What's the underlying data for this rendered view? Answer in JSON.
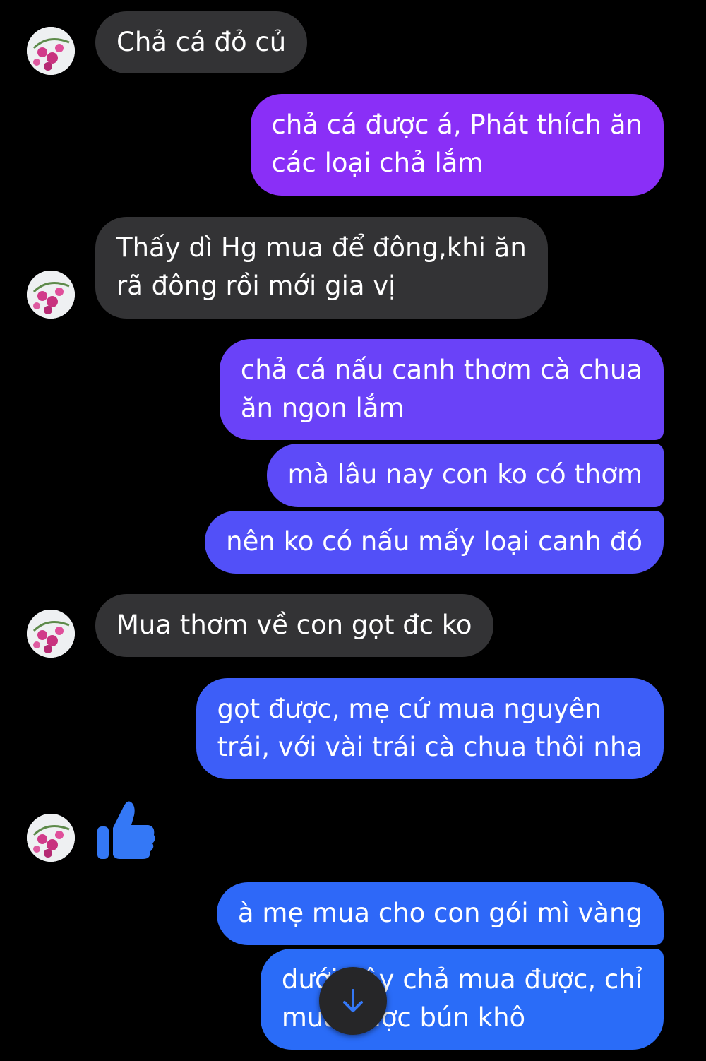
{
  "theme": {
    "background": "#000000",
    "incoming_bubble": "#333335",
    "outgoing_gradient_top": "#8C2EF7",
    "outgoing_gradient_bottom": "#1F6BF8",
    "accent_blue": "#3478F6"
  },
  "messages": [
    {
      "sender": "mother",
      "lines": [
        "Chả cá đỏ củ"
      ]
    },
    {
      "sender": "me",
      "lines": [
        "chả cá được á, Phát thích ăn",
        "các loại chả lắm"
      ]
    },
    {
      "sender": "mother",
      "lines": [
        "Thấy dì Hg mua để đông,khi ăn",
        "rã đông rồi mới gia vị"
      ]
    },
    {
      "sender": "me",
      "lines": [
        "chả cá nấu canh thơm cà chua",
        "ăn ngon lắm"
      ]
    },
    {
      "sender": "me",
      "lines": [
        "mà lâu nay con ko có thơm"
      ]
    },
    {
      "sender": "me",
      "lines": [
        "nên ko có nấu mấy loại canh đó"
      ]
    },
    {
      "sender": "mother",
      "lines": [
        "Mua thơm về con gọt đc ko"
      ]
    },
    {
      "sender": "me",
      "lines": [
        "gọt được, mẹ cứ mua nguyên",
        "trái, với vài trái cà chua thôi nha"
      ]
    },
    {
      "sender": "mother",
      "type": "like",
      "icon": "thumbs-up-icon"
    },
    {
      "sender": "me",
      "lines": [
        "à mẹ mua cho con gói mì vàng"
      ]
    },
    {
      "sender": "me",
      "lines": [
        "dưới đây chả mua được, chỉ",
        "mua được bún khô"
      ]
    }
  ],
  "avatar_icon": "flower-avatar-icon",
  "scroll_button_icon": "arrow-down-icon"
}
